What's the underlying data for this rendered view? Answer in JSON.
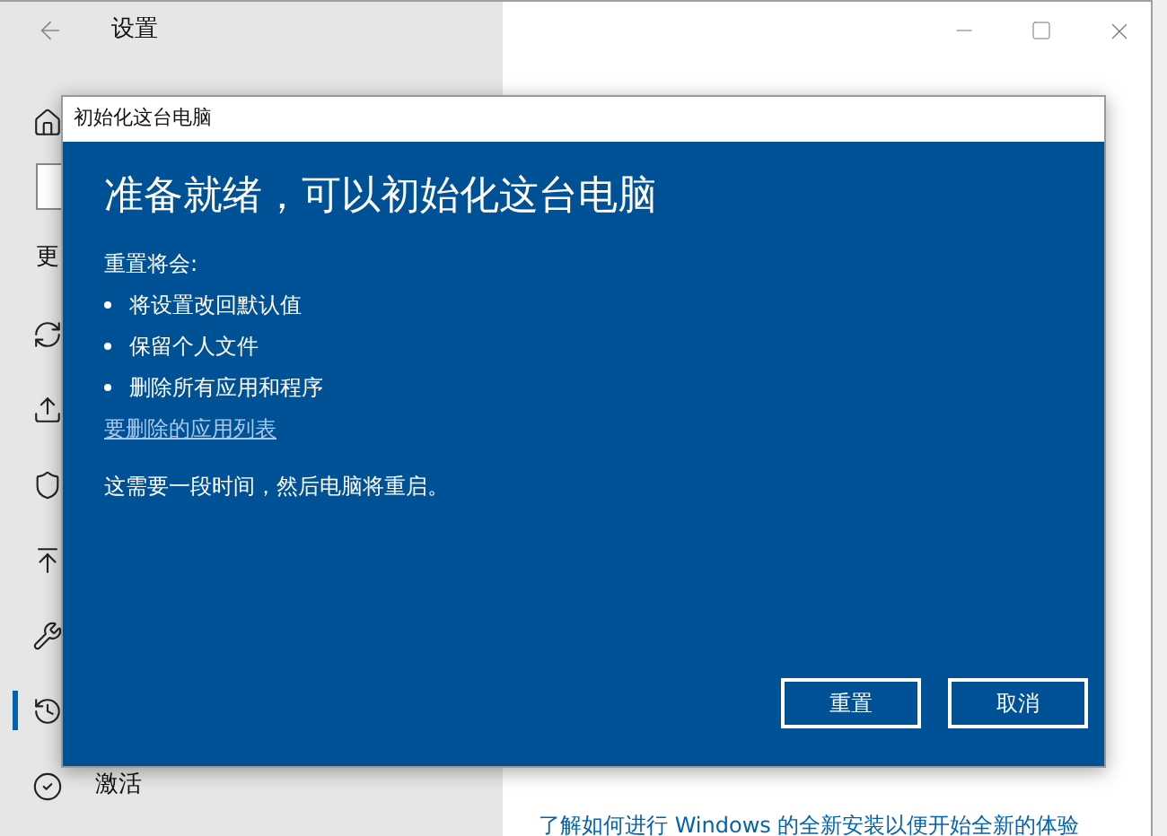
{
  "window": {
    "title": "设置"
  },
  "sidebar": {
    "items": [
      {
        "selected": false
      },
      {
        "label": "更",
        "selected": false
      },
      {
        "selected": false
      },
      {
        "selected": false
      },
      {
        "selected": false
      },
      {
        "selected": false
      },
      {
        "selected": false
      },
      {
        "selected": true
      },
      {
        "label": "激活",
        "selected": false
      }
    ]
  },
  "content": {
    "link": "了解如何进行 Windows 的全新安装以便开始全新的体验"
  },
  "dialog": {
    "title": "初始化这台电脑",
    "heading": "准备就绪，可以初始化这台电脑",
    "intro": "重置将会:",
    "bullets": [
      "将设置改回默认值",
      "保留个人文件",
      "删除所有应用和程序"
    ],
    "link": "要删除的应用列表",
    "note": "这需要一段时间，然后电脑将重启。",
    "buttons": [
      "重置",
      "取消"
    ]
  }
}
